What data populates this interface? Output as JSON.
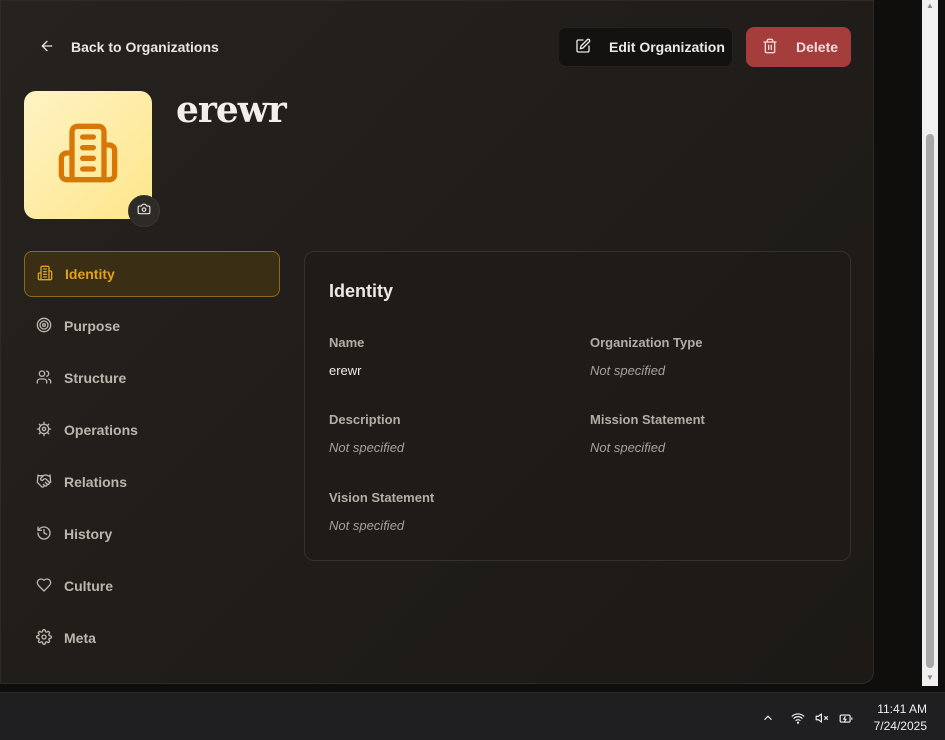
{
  "header": {
    "back_label": "Back to Organizations",
    "edit_label": "Edit Organization",
    "delete_label": "Delete"
  },
  "organization": {
    "name": "erewr"
  },
  "nav": {
    "items": [
      {
        "label": "Identity",
        "icon": "building-icon",
        "active": true
      },
      {
        "label": "Purpose",
        "icon": "target-icon"
      },
      {
        "label": "Structure",
        "icon": "users-icon"
      },
      {
        "label": "Operations",
        "icon": "cog-icon"
      },
      {
        "label": "Relations",
        "icon": "handshake-icon"
      },
      {
        "label": "History",
        "icon": "history-icon"
      },
      {
        "label": "Culture",
        "icon": "heart-icon"
      },
      {
        "label": "Meta",
        "icon": "settings-icon"
      }
    ]
  },
  "identity": {
    "title": "Identity",
    "fields": [
      {
        "label": "Name",
        "value": "erewr"
      },
      {
        "label": "Organization Type",
        "value": "Not specified"
      },
      {
        "label": "Description",
        "value": "Not specified"
      },
      {
        "label": "Mission Statement",
        "value": "Not specified"
      },
      {
        "label": "Vision Statement",
        "value": "Not specified"
      }
    ]
  },
  "taskbar": {
    "time": "11:41 AM",
    "date": "7/24/2025"
  },
  "colors": {
    "accent": "#e0a21d",
    "danger": "#a43d3b",
    "avatar_bg": "#fde68a"
  }
}
